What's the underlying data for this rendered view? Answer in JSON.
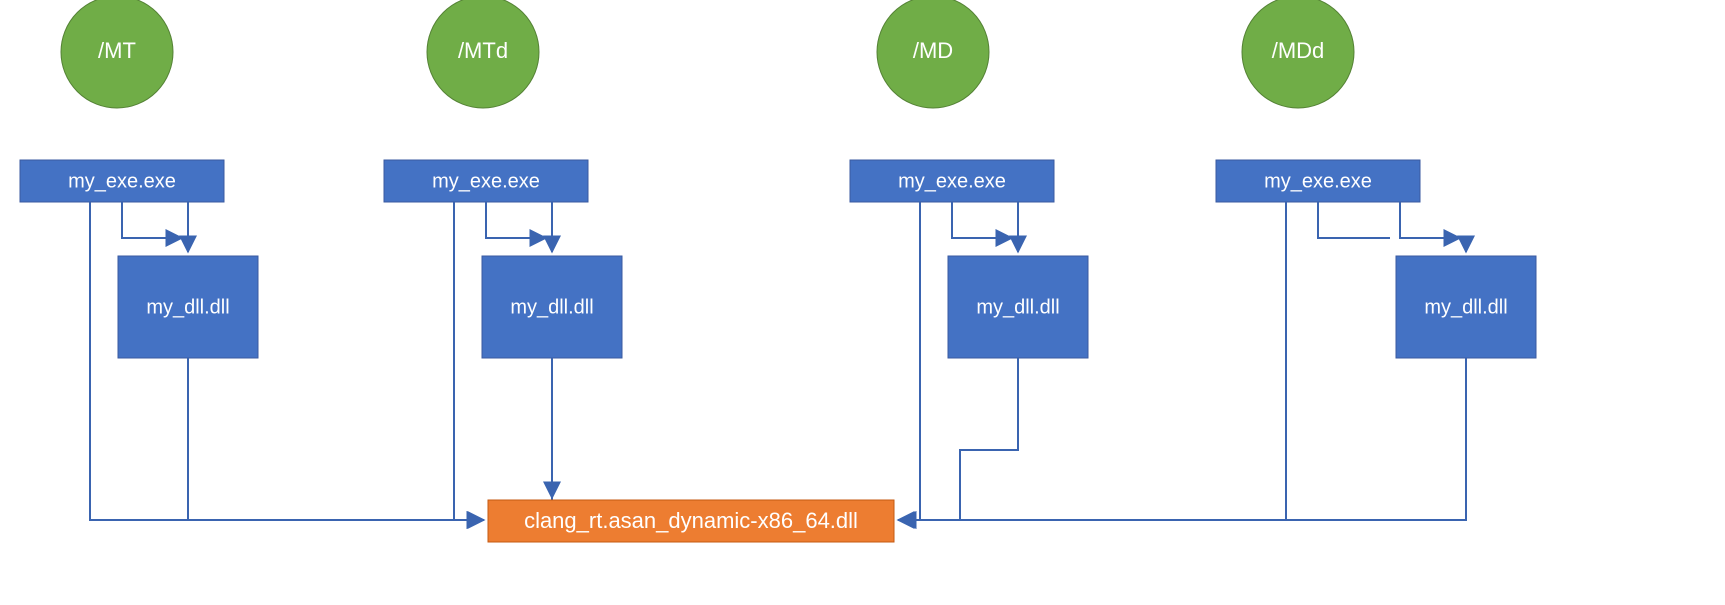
{
  "colors": {
    "green": "#70ad47",
    "blue": "#4472c4",
    "blueStroke": "#3a5aa0",
    "orange": "#ed7d31",
    "connector": "#3a64b0"
  },
  "columns": [
    {
      "flag": "/MT",
      "exe": "my_exe.exe",
      "dll": "my_dll.dll"
    },
    {
      "flag": "/MTd",
      "exe": "my_exe.exe",
      "dll": "my_dll.dll"
    },
    {
      "flag": "/MD",
      "exe": "my_exe.exe",
      "dll": "my_dll.dll"
    },
    {
      "flag": "/MDd",
      "exe": "my_exe.exe",
      "dll": "my_dll.dll"
    }
  ],
  "target": "clang_rt.asan_dynamic-x86_64.dll"
}
